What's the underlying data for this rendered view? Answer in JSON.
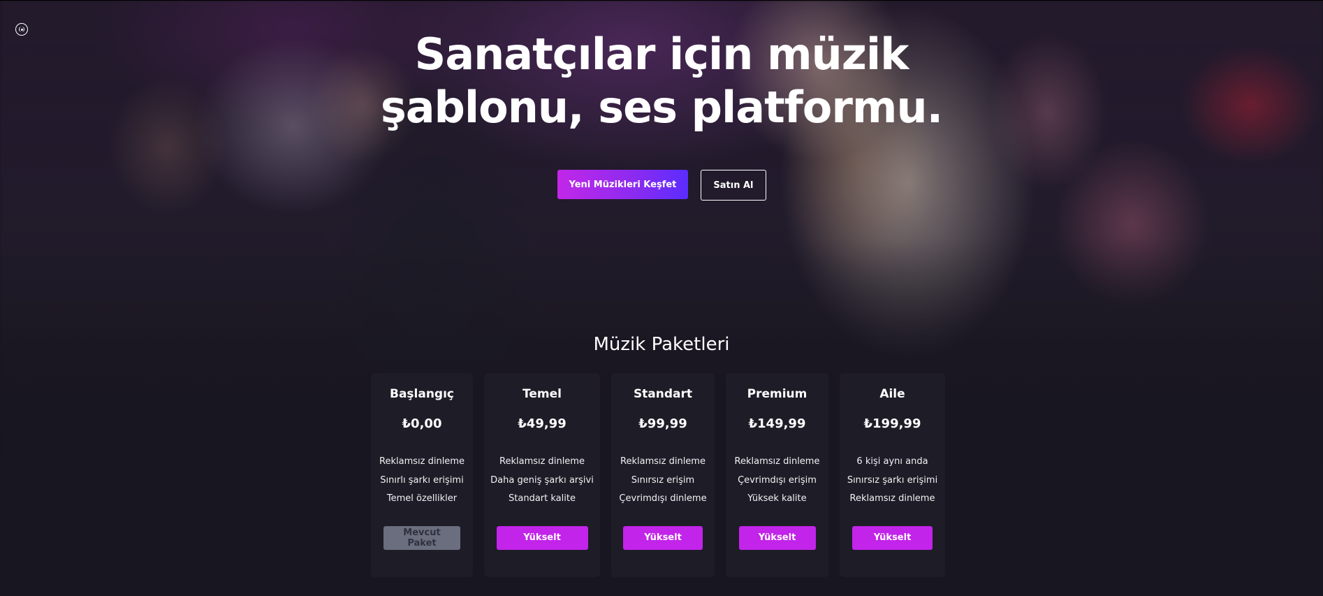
{
  "hero": {
    "headline_line1": "Sanatçılar için müzik",
    "headline_line2": "şablonu, ses platformu.",
    "primary_button": "Yeni Müzikleri Keşfet",
    "secondary_button": "Satın Al"
  },
  "logo": {
    "icon": "radio-broadcast-icon"
  },
  "packages": {
    "title": "Müzik Paketleri",
    "items": [
      {
        "name": "Başlangıç",
        "price": "₺0,00",
        "features": [
          "Reklamsız dinleme",
          "Sınırlı şarkı erişimi",
          "Temel özellikler"
        ],
        "button": "Mevcut Paket",
        "current": true
      },
      {
        "name": "Temel",
        "price": "₺49,99",
        "features": [
          "Reklamsız dinleme",
          "Daha geniş şarkı arşivi",
          "Standart kalite"
        ],
        "button": "Yükselt",
        "current": false
      },
      {
        "name": "Standart",
        "price": "₺99,99",
        "features": [
          "Reklamsız dinleme",
          "Sınırsız erişim",
          "Çevrimdışı dinleme"
        ],
        "button": "Yükselt",
        "current": false
      },
      {
        "name": "Premium",
        "price": "₺149,99",
        "features": [
          "Reklamsız dinleme",
          "Çevrimdışı erişim",
          "Yüksek kalite"
        ],
        "button": "Yükselt",
        "current": false
      },
      {
        "name": "Aile",
        "price": "₺199,99",
        "features": [
          "6 kişi aynı anda",
          "Sınırsız şarkı erişimi",
          "Reklamsız dinleme"
        ],
        "button": "Yükselt",
        "current": false
      }
    ]
  },
  "colors": {
    "accent": "#c224ea",
    "gradient_end": "#5b2cff",
    "card_bg": "#1e1d28",
    "disabled_button": "#6b6e7e"
  }
}
